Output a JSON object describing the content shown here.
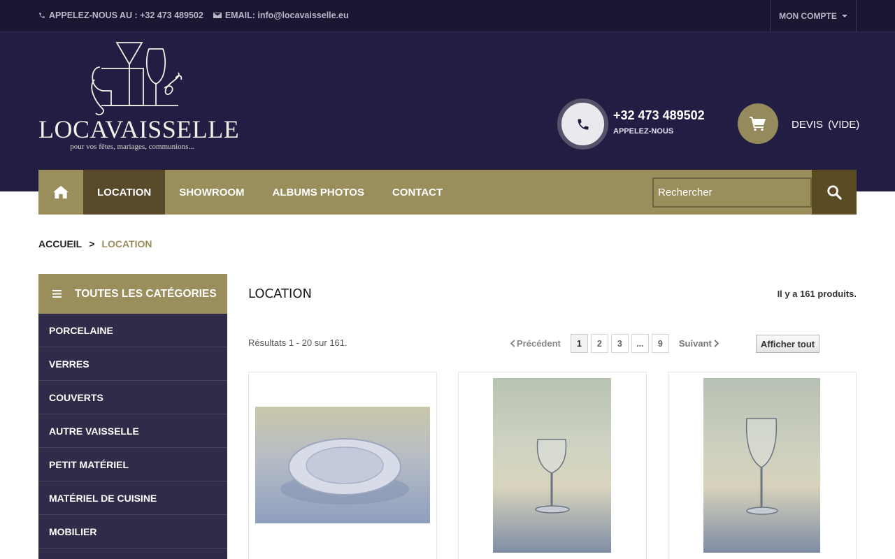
{
  "topbar": {
    "phone_text": "APPELEZ-NOUS AU : +32 473 489502",
    "email_text": "EMAIL: info@locavaisselle.eu",
    "account_label": "MON COMPTE"
  },
  "header": {
    "brand": "LOCAVAISSELLE",
    "tagline": "pour vos fêtes, mariages, communions...",
    "phone_number": "+32 473 489502",
    "phone_sub": "APPELEZ-NOUS",
    "devis_label": "DEVIS",
    "devis_status": "(VIDE)"
  },
  "nav": {
    "items": [
      {
        "label": "LOCATION",
        "active": true
      },
      {
        "label": "SHOWROOM"
      },
      {
        "label": "ALBUMS PHOTOS"
      },
      {
        "label": "CONTACT"
      }
    ],
    "search_placeholder": "Rechercher"
  },
  "breadcrumb": {
    "home": "ACCUEIL",
    "separator": ">",
    "current": "LOCATION"
  },
  "sidebar": {
    "title": "TOUTES LES CATÉGORIES",
    "items": [
      "PORCELAINE",
      "VERRES",
      "COUVERTS",
      "AUTRE VAISSELLE",
      "PETIT MATÉRIEL",
      "MATÉRIEL DE CUISINE",
      "MOBILIER"
    ]
  },
  "main": {
    "title": "LOCATION",
    "count_text": "Il y a 161 produits.",
    "results_text": "Résultats 1 - 20 sur 161.",
    "pagination": {
      "prev": "Précédent",
      "pages": [
        "1",
        "2",
        "3",
        "...",
        "9"
      ],
      "current": "1",
      "next": "Suivant"
    },
    "show_all": "Afficher tout"
  },
  "colors": {
    "navy": "#221d43",
    "gold": "#9a8e5c",
    "gold_dark": "#57492a",
    "sidebar": "#2f2b48"
  }
}
